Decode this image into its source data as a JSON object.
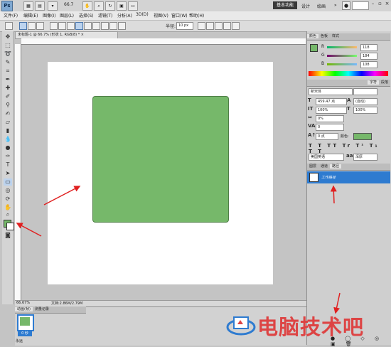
{
  "app": {
    "logo": "Ps",
    "zoom": "66.7"
  },
  "workspace": {
    "essentials": "基本功能",
    "design": "设计",
    "painting": "绘画"
  },
  "menu": [
    "文件(F)",
    "编辑(E)",
    "图像(I)",
    "图层(L)",
    "选择(S)",
    "滤镜(T)",
    "分析(A)",
    "3D(D)",
    "视图(V)",
    "窗口(W)",
    "帮助(H)"
  ],
  "options_bar": {
    "radius_label": "半径:",
    "radius_value": "10 px"
  },
  "document": {
    "tab_title": "未标题-1 @ 66.7% (形状 1, RGB/8) * ×",
    "zoom": "66.67%",
    "doc_size": "文档:2.86M/2.79M",
    "shape_color": "#76b86a"
  },
  "color_panel": {
    "tabs": [
      "颜色",
      "色板",
      "样式"
    ],
    "r_label": "R",
    "r_value": "118",
    "g_label": "G",
    "g_value": "184",
    "b_label": "B",
    "b_value": "108"
  },
  "char_panel": {
    "tabs": [
      "字符",
      "段落"
    ],
    "font_family": "新宋体",
    "font_size": "459.47 点",
    "leading": "(自动)",
    "vert_scale": "100%",
    "horiz_scale": "100%",
    "tracking_ratio": "0%",
    "tracking": "0",
    "baseline": "0 点",
    "color_label": "颜色:",
    "language": "美国英语",
    "anti_alias": "浑厚"
  },
  "layers_panel": {
    "tabs": [
      "图层",
      "通道",
      "路径"
    ],
    "layer_name": "工作路径"
  },
  "animation_panel": {
    "tabs": [
      "动画(帧)",
      "测量记录"
    ],
    "frame_time": "0 秒",
    "loop": "永远"
  },
  "watermark": {
    "text": "电脑技术吧"
  },
  "colors": {
    "accent": "#2e7bd0",
    "arrow": "#e02020"
  }
}
